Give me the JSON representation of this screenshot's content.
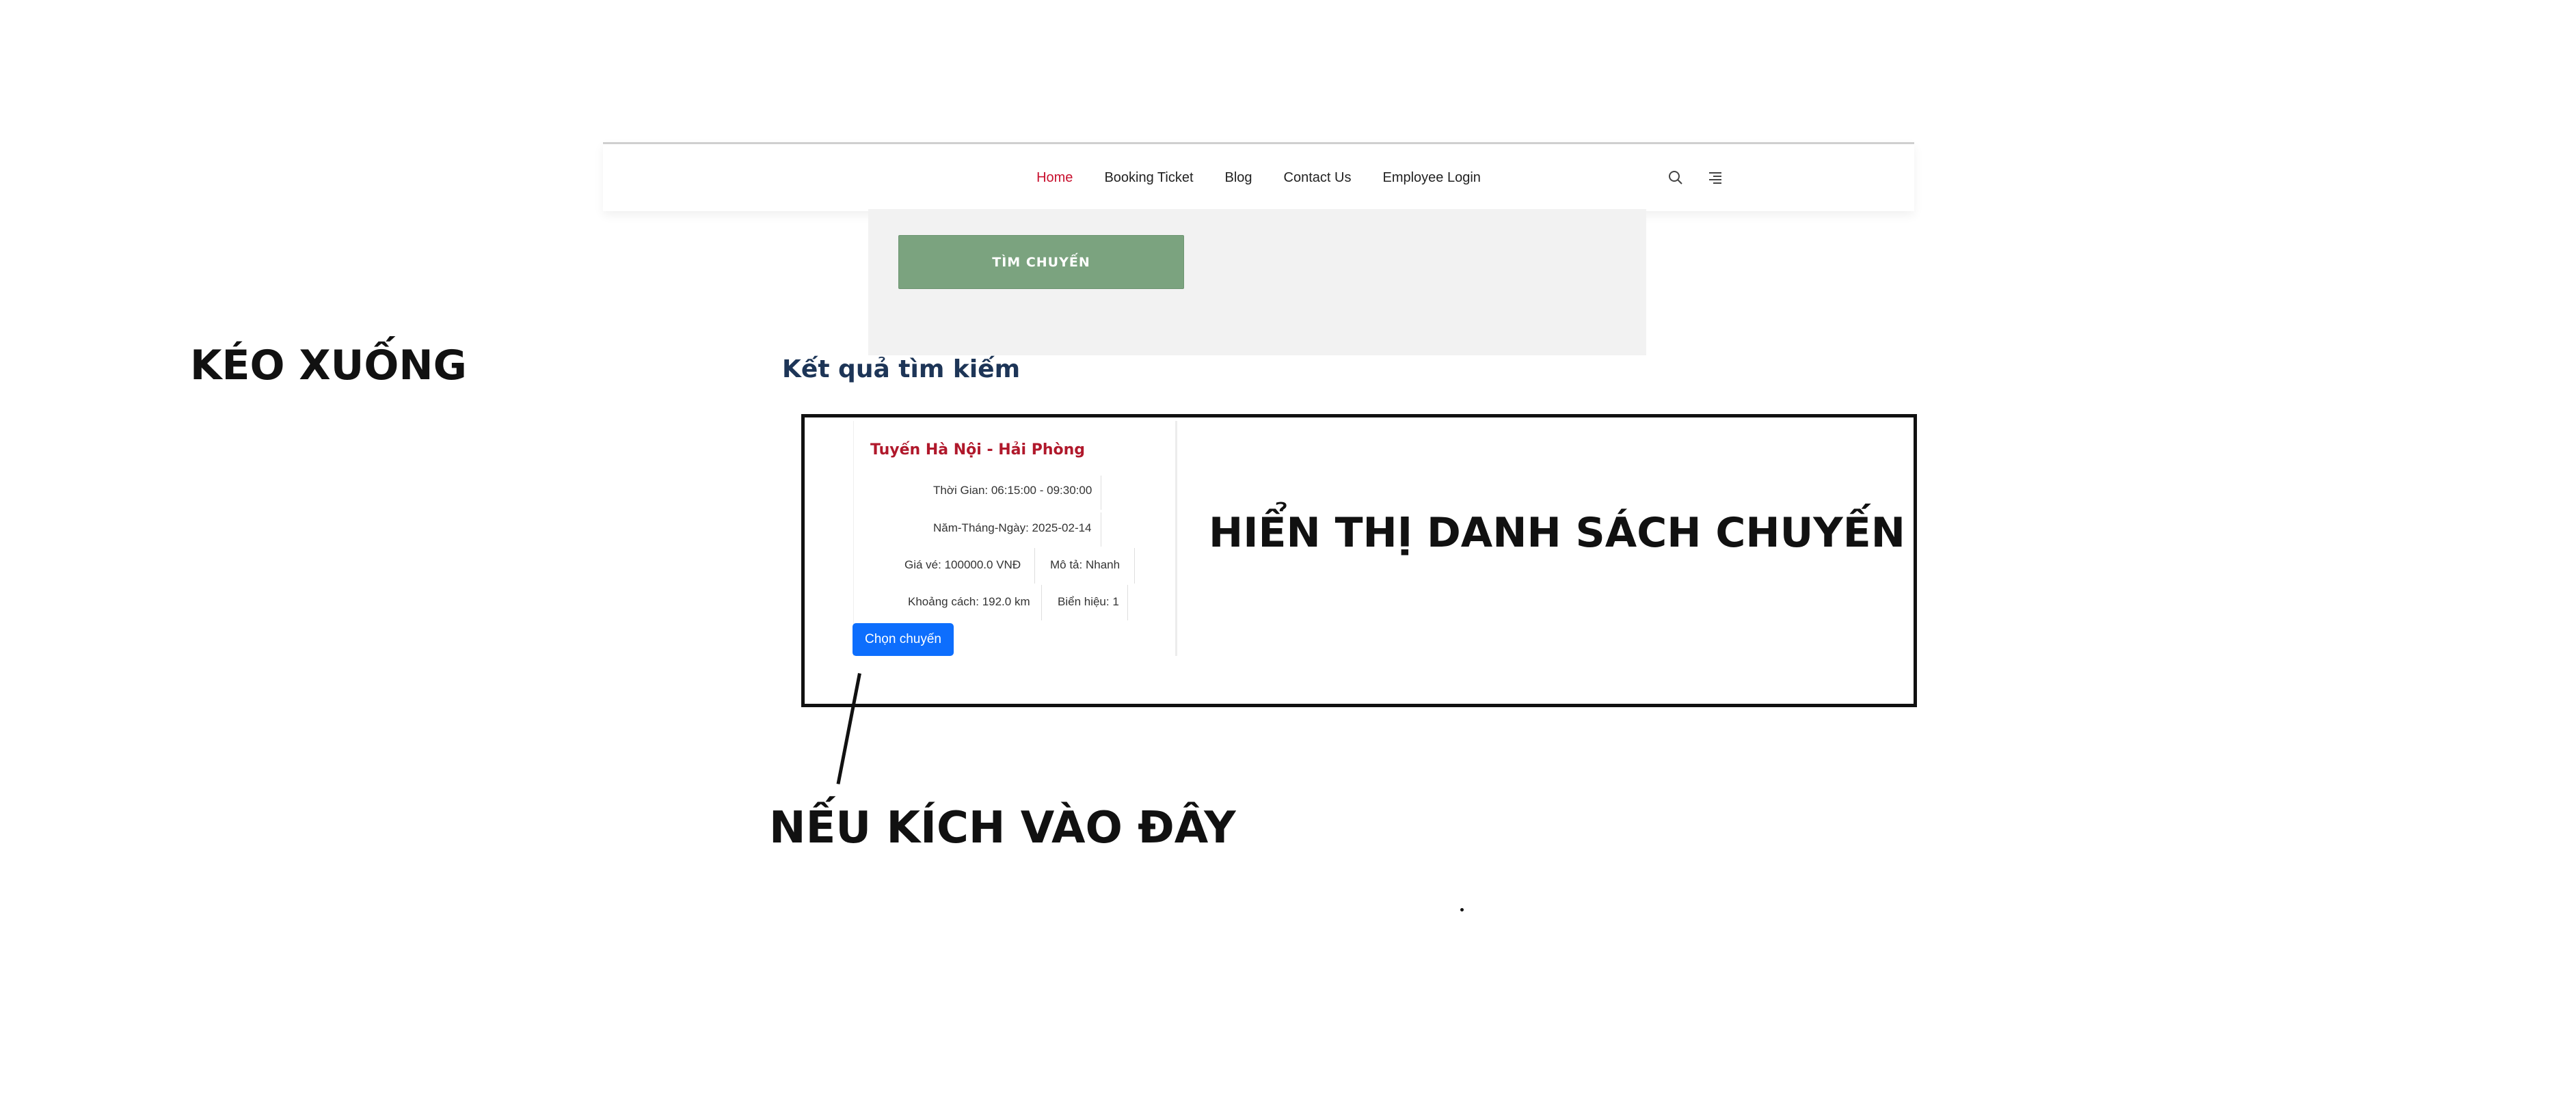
{
  "nav": {
    "links": [
      "Home",
      "Booking Ticket",
      "Blog",
      "Contact Us",
      "Employee Login"
    ],
    "active_link": "Home",
    "icons": [
      "search-icon",
      "menu-icon"
    ]
  },
  "search": {
    "button_label": "TÌM CHUYẾN"
  },
  "results": {
    "title": "Kết quả tìm kiếm",
    "trips": [
      {
        "route": "Tuyến Hà Nội - Hải Phòng",
        "time": "Thời Gian: 06:15:00 - 09:30:00",
        "date": "Năm-Tháng-Ngày: 2025-02-14",
        "price": "Giá vé: 100000.0 VNĐ",
        "description": "Mô tả: Nhanh",
        "distance": "Khoảng cách: 192.0 km",
        "plate": "Biển hiệu: 1",
        "choose_label": "Chọn chuyến"
      }
    ]
  },
  "annotations": {
    "scroll_down": "KÉO XUỐNG",
    "list_display": "HIỂN THỊ DANH SÁCH CHUYẾN",
    "click_here": "NẾU KÍCH VÀO ĐÂY"
  },
  "colors": {
    "active_nav": "#c8102e",
    "search_button": "#7ba37f",
    "route_title": "#b0182b",
    "choose_button": "#0d6efd",
    "results_title": "#1d3557"
  }
}
